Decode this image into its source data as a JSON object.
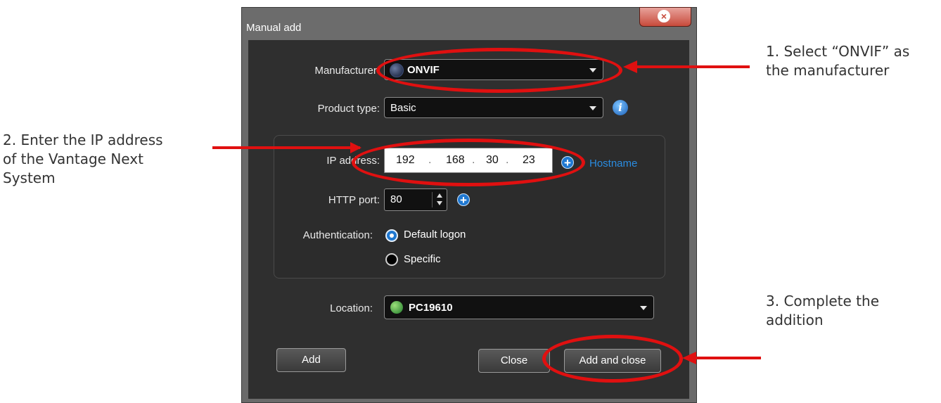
{
  "dialog": {
    "title": "Manual add",
    "close_glyph": "×",
    "manufacturer": {
      "label": "Manufacturer:",
      "value": "ONVIF"
    },
    "product_type": {
      "label": "Product type:",
      "value": "Basic",
      "info_glyph": "i"
    },
    "ip_address": {
      "label": "IP address:",
      "octets": [
        "192",
        "168",
        "30",
        "23"
      ],
      "separator": ".",
      "hostname_link": "Hostname"
    },
    "http_port": {
      "label": "HTTP port:",
      "value": "80"
    },
    "authentication": {
      "label": "Authentication:",
      "options": [
        "Default logon",
        "Specific"
      ],
      "selected": "Default logon"
    },
    "location": {
      "label": "Location:",
      "value": "PC19610"
    },
    "buttons": {
      "add": "Add",
      "close": "Close",
      "add_and_close": "Add and close"
    },
    "plus_glyph": "+"
  },
  "annotations": {
    "step1": [
      "1. Select “ONVIF” as",
      "the manufacturer"
    ],
    "step2": [
      "2. Enter the IP address",
      "of the Vantage Next",
      "System"
    ],
    "step3": [
      "3. Complete the",
      "addition"
    ]
  },
  "colors": {
    "highlight": "#e01010",
    "accent": "#1f78d1",
    "link": "#2a8ce0",
    "dialog_bg": "#2f2f2f"
  },
  "icons": [
    "close-icon",
    "onvif-globe-icon",
    "info-icon",
    "plus-icon",
    "location-globe-icon",
    "radio-icon"
  ]
}
